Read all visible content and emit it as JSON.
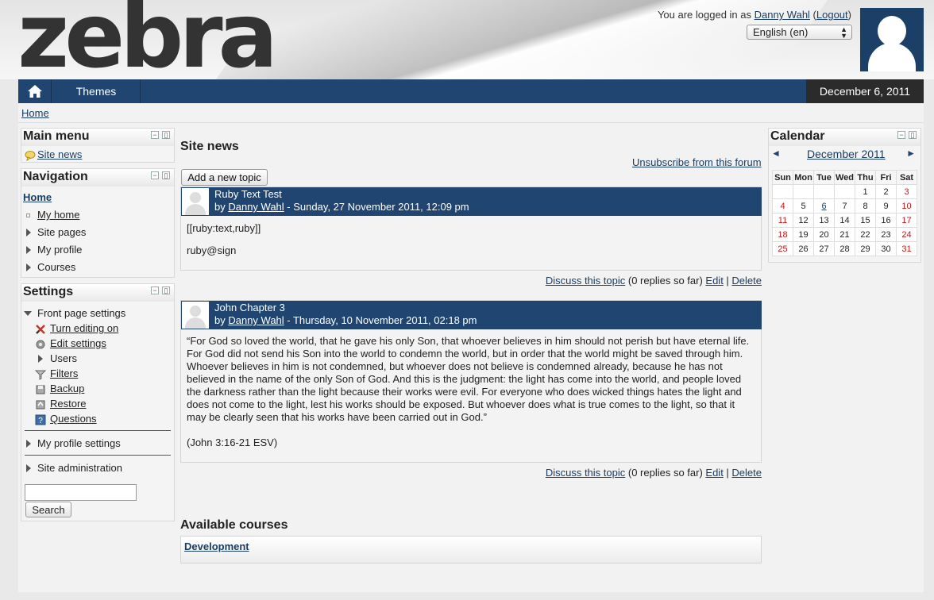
{
  "header": {
    "logo_text": "zebra",
    "login_prefix": "You are logged in as ",
    "user_name": "Danny Wahl",
    "logout_label": "Logout",
    "language": "English (en)"
  },
  "navbar": {
    "themes_label": "Themes",
    "date": "December 6, 2011"
  },
  "breadcrumb": {
    "home": "Home"
  },
  "main_menu": {
    "title": "Main menu",
    "items": [
      "Site news"
    ]
  },
  "navigation": {
    "title": "Navigation",
    "home": "Home",
    "items": [
      "My home",
      "Site pages",
      "My profile",
      "Courses"
    ]
  },
  "settings": {
    "title": "Settings",
    "front_page": "Front page settings",
    "front_page_items": [
      "Turn editing on",
      "Edit settings",
      "Users",
      "Filters",
      "Backup",
      "Restore",
      "Questions"
    ],
    "my_profile": "My profile settings",
    "site_admin": "Site administration",
    "search_button": "Search",
    "search_value": ""
  },
  "main": {
    "site_news_title": "Site news",
    "unsubscribe": "Unsubscribe from this forum",
    "add_topic": "Add a new topic",
    "posts": [
      {
        "subject": "Ruby Text Test",
        "by": "by ",
        "author": "Danny Wahl",
        "date": " - Sunday, 27 November 2011, 12:09 pm",
        "body": [
          "[[ruby:text,ruby]]",
          "ruby@sign"
        ],
        "discuss": "Discuss this topic",
        "replies": " (0 replies so far) ",
        "edit": "Edit",
        "sep": " | ",
        "delete": "Delete"
      },
      {
        "subject": "John Chapter 3",
        "by": "by ",
        "author": "Danny Wahl",
        "date": " - Thursday, 10 November 2011, 02:18 pm",
        "body": [
          "“For God so loved the world, that he gave his only Son, that whoever believes in him should not perish but have eternal life. For God did not send his Son into the world to condemn the world, but in order that the world might be saved through him. Whoever believes in him is not condemned, but whoever does not believe is condemned already, because he has not believed in the name of the only Son of God. And this is the judgment: the light has come into the world, and people loved the darkness rather than the light because their works were evil. For everyone who does wicked things hates the light and does not come to the light, lest his works should be exposed. But whoever does what is true comes to the light, so that it may be clearly seen that his works have been carried out in God.”",
          "(John 3:16-21 ESV)"
        ],
        "discuss": "Discuss this topic",
        "replies": " (0 replies so far) ",
        "edit": "Edit",
        "sep": " | ",
        "delete": "Delete"
      }
    ],
    "courses_title": "Available courses",
    "course": "Development"
  },
  "calendar": {
    "title": "Calendar",
    "month": "December 2011",
    "prev": "◄",
    "next": "►",
    "days": [
      "Sun",
      "Mon",
      "Tue",
      "Wed",
      "Thu",
      "Fri",
      "Sat"
    ],
    "weeks": [
      [
        "",
        "",
        "",
        "",
        "1",
        "2",
        "3"
      ],
      [
        "4",
        "5",
        "6",
        "7",
        "8",
        "9",
        "10"
      ],
      [
        "11",
        "12",
        "13",
        "14",
        "15",
        "16",
        "17"
      ],
      [
        "18",
        "19",
        "20",
        "21",
        "22",
        "23",
        "24"
      ],
      [
        "25",
        "26",
        "27",
        "28",
        "29",
        "30",
        "31"
      ]
    ],
    "linked_day": "6",
    "weekend_color": "#c01818"
  },
  "colors": {
    "brand_blue": "#1f4570",
    "date_bg": "#2b2b2b",
    "link": "#1a3d63"
  }
}
